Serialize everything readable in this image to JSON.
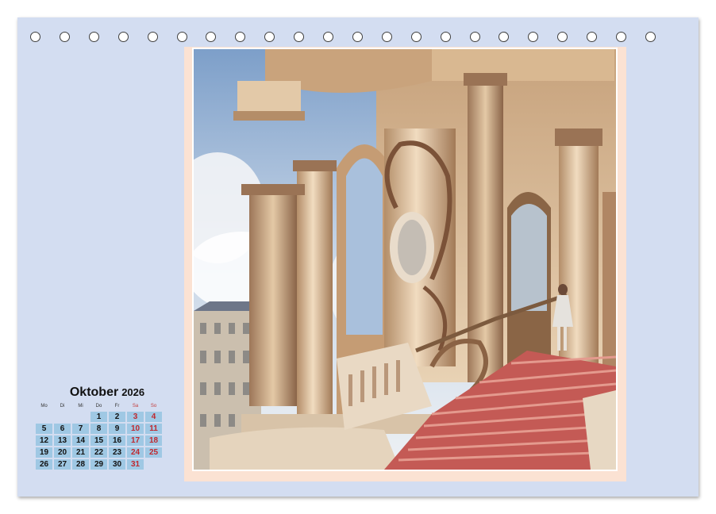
{
  "calendar": {
    "month": "Oktober",
    "year": "2026",
    "weekdays": [
      "Mo",
      "Di",
      "Mi",
      "Do",
      "Fr",
      "Sa",
      "So"
    ],
    "weeks": [
      [
        "",
        "",
        "",
        "1",
        "2",
        "3",
        "4"
      ],
      [
        "5",
        "6",
        "7",
        "8",
        "9",
        "10",
        "11"
      ],
      [
        "12",
        "13",
        "14",
        "15",
        "16",
        "17",
        "18"
      ],
      [
        "19",
        "20",
        "21",
        "22",
        "23",
        "24",
        "25"
      ],
      [
        "26",
        "27",
        "28",
        "29",
        "30",
        "31",
        ""
      ]
    ]
  },
  "colors": {
    "page_background": "#d3ddf1",
    "photo_frame": "#fbe2d3",
    "day_cell": "#9fc8e4",
    "weekend_text": "#c0282e"
  },
  "binding_holes": 22,
  "photo": {
    "subject": "watercolor-baroque-palace-staircase"
  }
}
